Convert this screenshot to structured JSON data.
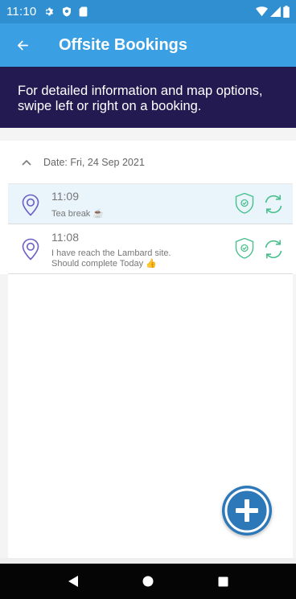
{
  "status_bar": {
    "time": "11:10",
    "icons": [
      "gear-icon",
      "shield-dot-icon",
      "sd-card-icon"
    ],
    "right_icons": [
      "wifi-icon",
      "cell-signal-icon",
      "battery-icon"
    ]
  },
  "app_bar": {
    "back_icon": "arrow-left-icon",
    "title": "Offsite Bookings"
  },
  "info_banner": {
    "text": "For detailed information and map options, swipe left or right on a booking."
  },
  "date_group": {
    "label": "Date: Fri, 24 Sep 2021",
    "icon": "chevron-up-icon"
  },
  "bookings": [
    {
      "time": "11:09",
      "note": "Tea break ☕",
      "selected": true,
      "icons": [
        "location-pin-icon",
        "shield-check-icon",
        "sync-icon"
      ]
    },
    {
      "time": "11:08",
      "note_line1": "I have reach the Lambard site.",
      "note_line2": "Should complete Today 👍",
      "selected": false,
      "icons": [
        "location-pin-icon",
        "shield-check-icon",
        "sync-icon"
      ]
    }
  ],
  "fab": {
    "icon": "plus-icon"
  },
  "nav_bar": {
    "icons": [
      "back-triangle-icon",
      "home-circle-icon",
      "recents-square-icon"
    ]
  },
  "colors": {
    "status_bar": "#2f8fd0",
    "app_bar": "#3b9fe3",
    "banner": "#231a52",
    "selected_row": "#e9f4fb",
    "pin": "#6b5fc4",
    "green": "#47c08c",
    "fab": "#2d78b8"
  }
}
